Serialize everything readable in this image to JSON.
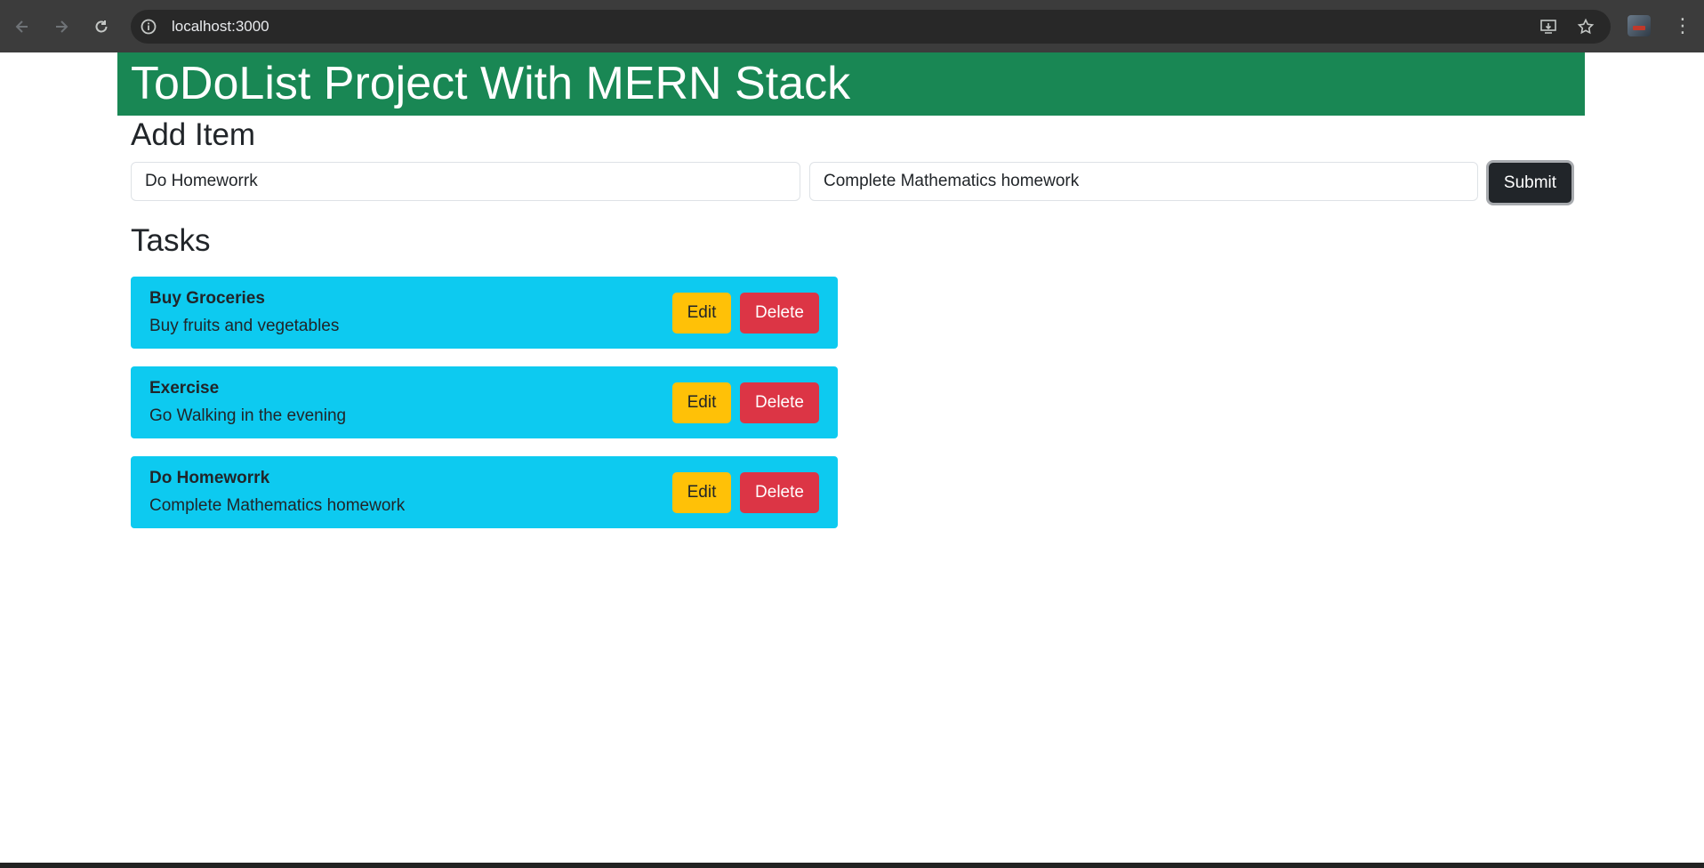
{
  "browser": {
    "url": "localhost:3000",
    "back_icon": "arrow-left-icon",
    "forward_icon": "arrow-right-icon",
    "reload_icon": "reload-icon",
    "site_info_icon": "info-icon",
    "install_icon": "install-app-icon",
    "bookmark_icon": "star-icon",
    "menu_icon": "kebab-menu-icon"
  },
  "header": {
    "title": "ToDoList Project With MERN Stack",
    "bg_color": "#198754"
  },
  "add_item": {
    "heading": "Add Item",
    "title_value": "Do Homeworrk",
    "description_value": "Complete Mathematics homework",
    "submit_label": "Submit"
  },
  "tasks": {
    "heading": "Tasks",
    "card_color": "#0dcaf0",
    "edit_label": "Edit",
    "delete_label": "Delete",
    "items": [
      {
        "title": "Buy Groceries",
        "description": "Buy fruits and vegetables"
      },
      {
        "title": "Exercise",
        "description": "Go Walking in the evening"
      },
      {
        "title": "Do Homeworrk",
        "description": "Complete Mathematics homework"
      }
    ]
  }
}
